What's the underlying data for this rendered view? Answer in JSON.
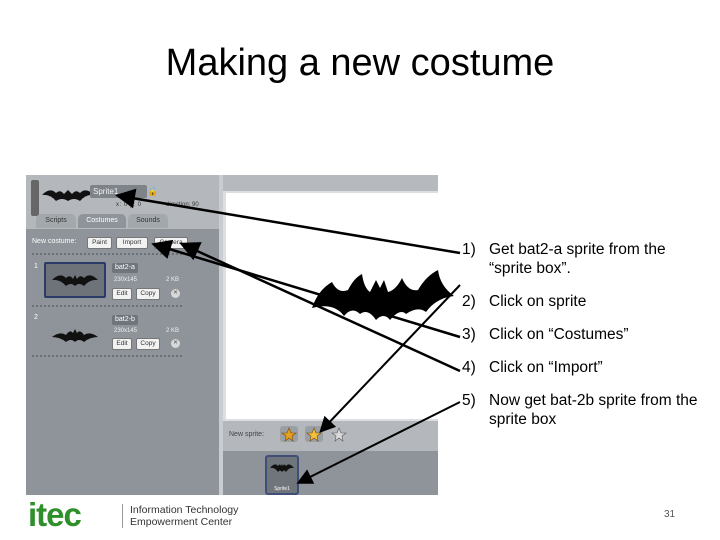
{
  "slide": {
    "title": "Making a new costume",
    "page_number": "31"
  },
  "scratch": {
    "sprite_name": "Sprite1",
    "x_readout": "x: 0",
    "y_readout": "y: 0",
    "direction_readout": "direction: 90",
    "tabs": [
      {
        "label": "Scripts",
        "active": false
      },
      {
        "label": "Costumes",
        "active": true
      },
      {
        "label": "Sounds",
        "active": false
      }
    ],
    "new_costume_label": "New costume:",
    "buttons": {
      "paint": "Paint",
      "import": "Import",
      "camera": "Camera"
    },
    "costumes": [
      {
        "number": "1",
        "name": "bat2-a",
        "size": "230x145",
        "kb": "2 KB",
        "edit": "Edit",
        "copy": "Copy"
      },
      {
        "number": "2",
        "name": "bat2-b",
        "size": "230x145",
        "kb": "2 KB",
        "edit": "Edit",
        "copy": "Copy"
      }
    ],
    "new_sprite_label": "New sprite:",
    "sprite_tile_label": "Sprite1"
  },
  "steps": [
    {
      "num": "1)",
      "text": "Get bat2-a sprite from the “sprite box”."
    },
    {
      "num": "2)",
      "text": "Click on sprite"
    },
    {
      "num": "3)",
      "text": "Click on “Costumes”"
    },
    {
      "num": "4)",
      "text": "Click on “Import”"
    },
    {
      "num": "5)",
      "text": "Now get bat-2b sprite from the sprite box"
    }
  ],
  "logo": {
    "wordmark": "itec",
    "line1": "Information Technology",
    "line2": "Empowerment Center",
    "brand_color": "#2f8f2a"
  },
  "icons": [
    "bat-icon",
    "lock-icon",
    "star-icon",
    "close-icon"
  ]
}
